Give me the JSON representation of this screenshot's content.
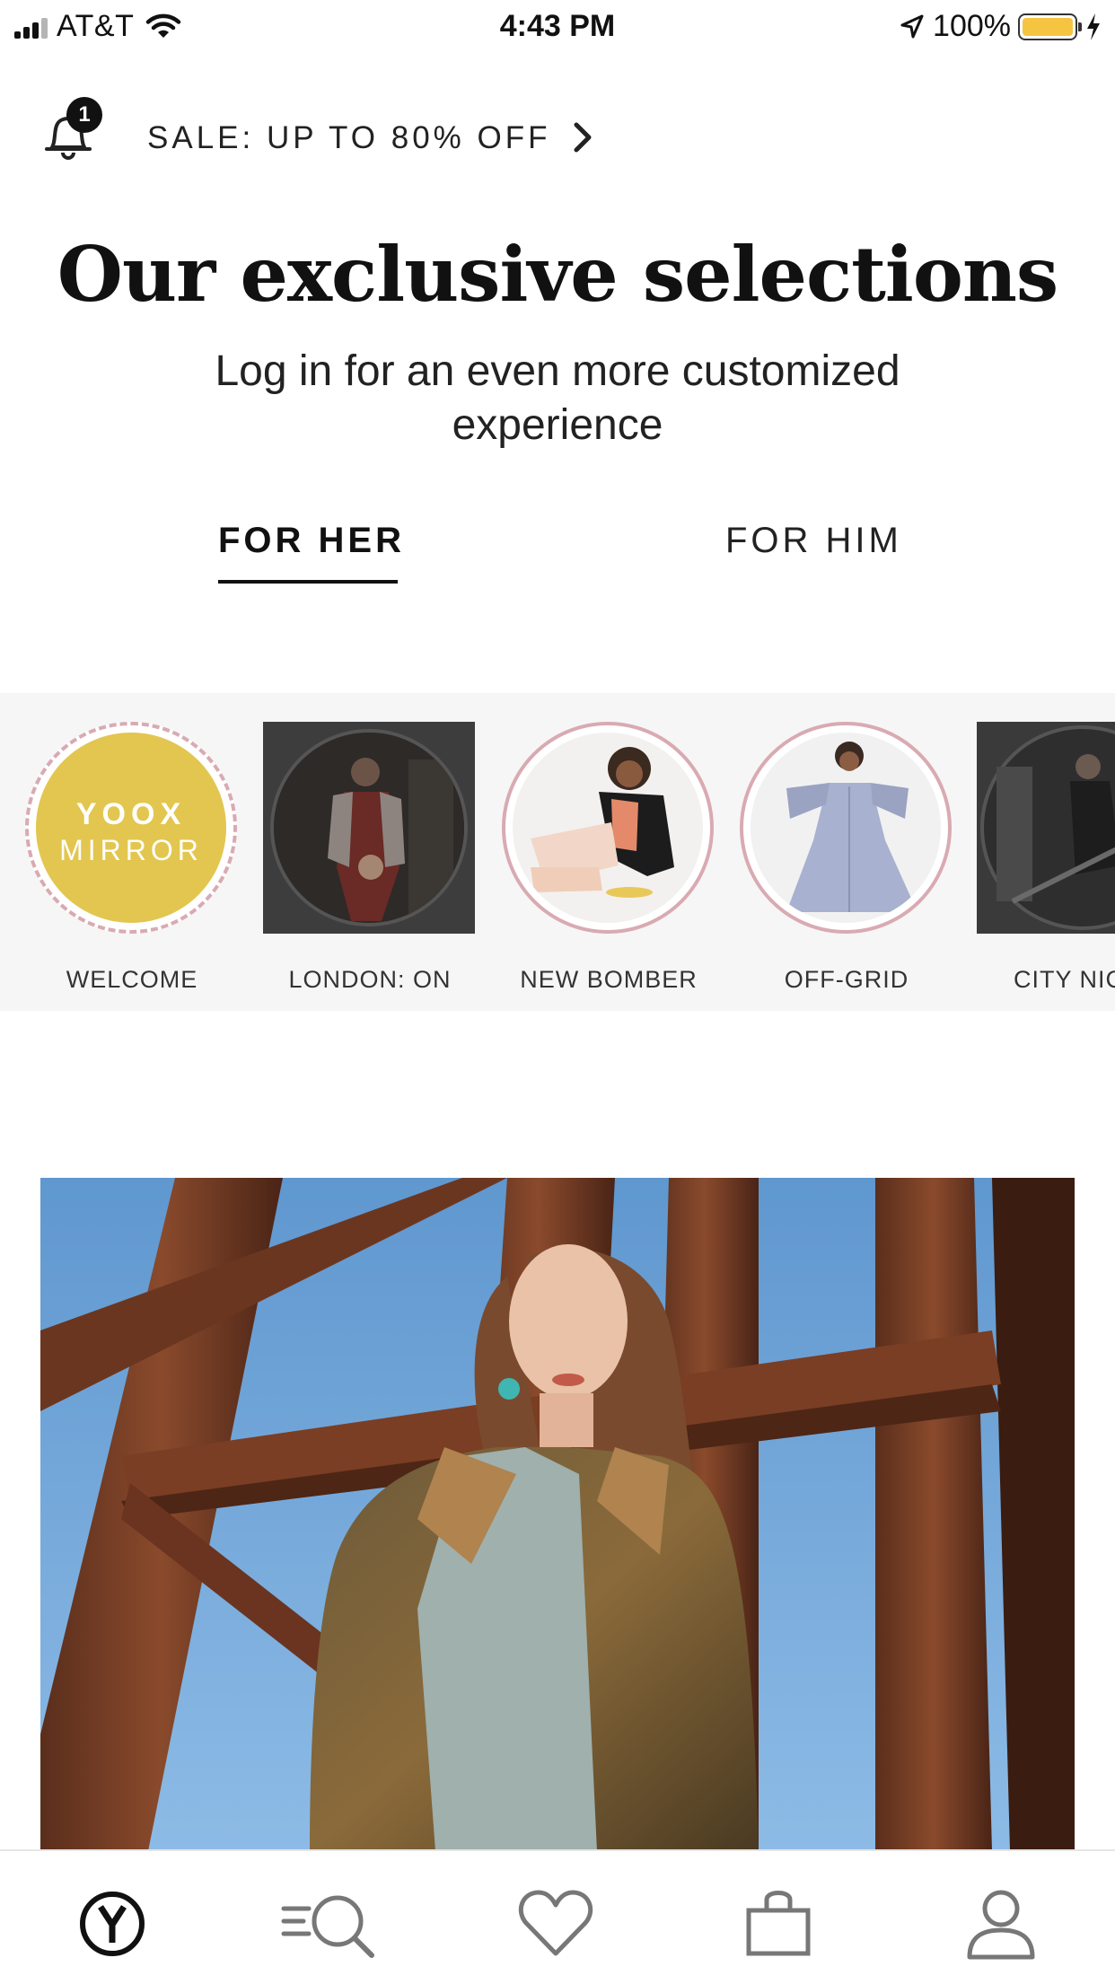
{
  "status_bar": {
    "carrier": "AT&T",
    "time": "4:43 PM",
    "battery": "100%",
    "battery_level": 1.0
  },
  "sale_banner": {
    "notification_count": "1",
    "text": "SALE: UP TO 80% OFF"
  },
  "header": {
    "title": "Our exclusive selections",
    "subtitle": "Log in for an even more customized experience"
  },
  "tabs": [
    {
      "label": "FOR HER",
      "selected": true
    },
    {
      "label": "FOR HIM",
      "selected": false
    }
  ],
  "stories": [
    {
      "label": "WELCOME",
      "logo_line1": "YOOX",
      "logo_line2": "MIRROR"
    },
    {
      "label": "LONDON: ON"
    },
    {
      "label": "NEW BOMBER"
    },
    {
      "label": "OFF-GRID"
    },
    {
      "label": "CITY NIC"
    }
  ],
  "bottom_nav": [
    {
      "icon": "home-logo-icon",
      "selected": true
    },
    {
      "icon": "search-menu-icon"
    },
    {
      "icon": "heart-icon"
    },
    {
      "icon": "bag-icon"
    },
    {
      "icon": "user-icon"
    }
  ],
  "colors": {
    "accent_yellow": "#e3c64f",
    "story_ring": "#d9aab2",
    "battery_fill": "#f5c542"
  }
}
